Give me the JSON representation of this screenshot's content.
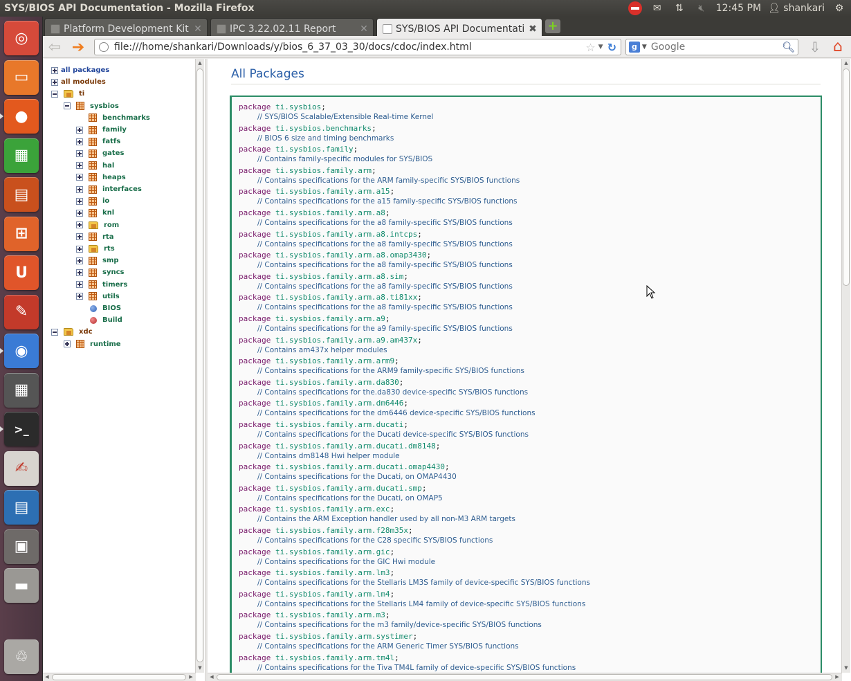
{
  "window": {
    "title": "SYS/BIOS API Documentation - Mozilla Firefox"
  },
  "top_panel": {
    "time": "12:45 PM",
    "user": "shankari"
  },
  "launcher": [
    {
      "name": "ubuntu-dash-icon",
      "color": "#d64a3a"
    },
    {
      "name": "files-folder-icon",
      "color": "#e8782a"
    },
    {
      "name": "firefox-icon",
      "color": "#e3591e"
    },
    {
      "name": "spreadsheet-icon",
      "color": "#3ba33a"
    },
    {
      "name": "presentation-icon",
      "color": "#c9501d"
    },
    {
      "name": "software-center-icon",
      "color": "#e0632a"
    },
    {
      "name": "ubuntu-one-icon",
      "color": "#e0552a"
    },
    {
      "name": "system-settings-icon",
      "color": "#c33a2a"
    },
    {
      "name": "chromium-icon",
      "color": "#3a7bd5"
    },
    {
      "name": "calculator-icon",
      "color": "#555"
    },
    {
      "name": "terminal-icon",
      "color": "#2b2b2b"
    },
    {
      "name": "document-viewer-icon",
      "color": "#d8d4cf"
    },
    {
      "name": "writer-icon",
      "color": "#2d6fb3"
    },
    {
      "name": "workspace-switcher-icon",
      "color": "#6e6a68"
    },
    {
      "name": "disk-drive-icon",
      "color": "#9a9894"
    },
    {
      "name": "trash-icon",
      "color": "#aaa8a4"
    }
  ],
  "tabs": [
    {
      "label": "Platform Development Kit ...",
      "active": false
    },
    {
      "label": "IPC 3.22.02.11 Report",
      "active": false
    },
    {
      "label": "SYS/BIOS API Documentation",
      "active": true
    }
  ],
  "nav": {
    "url": "file:///home/shankari/Downloads/y/bios_6_37_03_30/docs/cdoc/index.html",
    "search_placeholder": "Google",
    "search_engine_letter": "g"
  },
  "tree": [
    {
      "label": "all packages",
      "expander": "plus",
      "icon": "none",
      "level": 0,
      "style": "root"
    },
    {
      "label": "all modules",
      "expander": "plus",
      "icon": "none",
      "level": 0,
      "style": "root-brown"
    },
    {
      "label": "ti",
      "expander": "minus",
      "icon": "folder",
      "level": 0,
      "style": "root-brown"
    },
    {
      "label": "sysbios",
      "expander": "minus",
      "icon": "pkg",
      "level": 1,
      "style": "pkg"
    },
    {
      "label": "benchmarks",
      "expander": "none",
      "icon": "pkg",
      "level": 2,
      "style": "pkg"
    },
    {
      "label": "family",
      "expander": "plus",
      "icon": "pkg",
      "level": 2,
      "style": "pkg"
    },
    {
      "label": "fatfs",
      "expander": "plus",
      "icon": "pkg",
      "level": 2,
      "style": "pkg"
    },
    {
      "label": "gates",
      "expander": "plus",
      "icon": "pkg",
      "level": 2,
      "style": "pkg"
    },
    {
      "label": "hal",
      "expander": "plus",
      "icon": "pkg",
      "level": 2,
      "style": "pkg"
    },
    {
      "label": "heaps",
      "expander": "plus",
      "icon": "pkg",
      "level": 2,
      "style": "pkg"
    },
    {
      "label": "interfaces",
      "expander": "plus",
      "icon": "pkg",
      "level": 2,
      "style": "pkg"
    },
    {
      "label": "io",
      "expander": "plus",
      "icon": "pkg",
      "level": 2,
      "style": "pkg"
    },
    {
      "label": "knl",
      "expander": "plus",
      "icon": "pkg",
      "level": 2,
      "style": "pkg"
    },
    {
      "label": "rom",
      "expander": "plus",
      "icon": "folder",
      "level": 2,
      "style": "pkg"
    },
    {
      "label": "rta",
      "expander": "plus",
      "icon": "pkg",
      "level": 2,
      "style": "pkg"
    },
    {
      "label": "rts",
      "expander": "plus",
      "icon": "folder",
      "level": 2,
      "style": "pkg"
    },
    {
      "label": "smp",
      "expander": "plus",
      "icon": "pkg",
      "level": 2,
      "style": "pkg"
    },
    {
      "label": "syncs",
      "expander": "plus",
      "icon": "pkg",
      "level": 2,
      "style": "pkg"
    },
    {
      "label": "timers",
      "expander": "plus",
      "icon": "pkg",
      "level": 2,
      "style": "pkg"
    },
    {
      "label": "utils",
      "expander": "plus",
      "icon": "pkg",
      "level": 2,
      "style": "pkg"
    },
    {
      "label": "BIOS",
      "expander": "none",
      "icon": "dot-blue",
      "level": 2,
      "style": "pkg"
    },
    {
      "label": "Build",
      "expander": "none",
      "icon": "dot-red",
      "level": 2,
      "style": "pkg"
    },
    {
      "label": "xdc",
      "expander": "minus",
      "icon": "folder",
      "level": 0,
      "style": "root-brown"
    },
    {
      "label": "runtime",
      "expander": "plus",
      "icon": "pkg",
      "level": 1,
      "style": "pkg"
    }
  ],
  "main": {
    "heading": "All Packages",
    "keyword": "package",
    "packages": [
      {
        "name": "ti.sysbios",
        "desc": "// SYS/BIOS Scalable/Extensible Real-time Kernel"
      },
      {
        "name": "ti.sysbios.benchmarks",
        "desc": "// BIOS 6 size and timing benchmarks"
      },
      {
        "name": "ti.sysbios.family",
        "desc": "// Contains family-specific modules for SYS/BIOS"
      },
      {
        "name": "ti.sysbios.family.arm",
        "desc": "// Contains specifications for the ARM family-specific SYS/BIOS functions"
      },
      {
        "name": "ti.sysbios.family.arm.a15",
        "desc": "// Contains specifications for the a15 family-specific SYS/BIOS functions"
      },
      {
        "name": "ti.sysbios.family.arm.a8",
        "desc": "// Contains specifications for the a8 family-specific SYS/BIOS functions"
      },
      {
        "name": "ti.sysbios.family.arm.a8.intcps",
        "desc": "// Contains specifications for the a8 family-specific SYS/BIOS functions"
      },
      {
        "name": "ti.sysbios.family.arm.a8.omap3430",
        "desc": "// Contains specifications for the a8 family-specific SYS/BIOS functions"
      },
      {
        "name": "ti.sysbios.family.arm.a8.sim",
        "desc": "// Contains specifications for the a8 family-specific SYS/BIOS functions"
      },
      {
        "name": "ti.sysbios.family.arm.a8.ti81xx",
        "desc": "// Contains specifications for the a8 family-specific SYS/BIOS functions"
      },
      {
        "name": "ti.sysbios.family.arm.a9",
        "desc": "// Contains specifications for the a9 family-specific SYS/BIOS functions"
      },
      {
        "name": "ti.sysbios.family.arm.a9.am437x",
        "desc": "// Contains am437x helper modules"
      },
      {
        "name": "ti.sysbios.family.arm.arm9",
        "desc": "// Contains specifications for the ARM9 family-specific SYS/BIOS functions"
      },
      {
        "name": "ti.sysbios.family.arm.da830",
        "desc": "// Contains specifications for the.da830 device-specific SYS/BIOS functions"
      },
      {
        "name": "ti.sysbios.family.arm.dm6446",
        "desc": "// Contains specifications for the dm6446 device-specific SYS/BIOS functions"
      },
      {
        "name": "ti.sysbios.family.arm.ducati",
        "desc": "// Contains specifications for the Ducati device-specific SYS/BIOS functions"
      },
      {
        "name": "ti.sysbios.family.arm.ducati.dm8148",
        "desc": "// Contains dm8148 Hwi helper module"
      },
      {
        "name": "ti.sysbios.family.arm.ducati.omap4430",
        "desc": "// Contains specifications for the Ducati, on OMAP4430"
      },
      {
        "name": "ti.sysbios.family.arm.ducati.smp",
        "desc": "// Contains specifications for the Ducati, on OMAP5"
      },
      {
        "name": "ti.sysbios.family.arm.exc",
        "desc": "// Contains the ARM Exception handler used by all non-M3 ARM targets"
      },
      {
        "name": "ti.sysbios.family.arm.f28m35x",
        "desc": "// Contains specifications for the C28 specific SYS/BIOS functions"
      },
      {
        "name": "ti.sysbios.family.arm.gic",
        "desc": "// Contains specifications for the GIC Hwi module"
      },
      {
        "name": "ti.sysbios.family.arm.lm3",
        "desc": "// Contains specifications for the Stellaris LM3S family of device-specific SYS/BIOS functions"
      },
      {
        "name": "ti.sysbios.family.arm.lm4",
        "desc": "// Contains specifications for the Stellaris LM4 family of device-specific SYS/BIOS functions"
      },
      {
        "name": "ti.sysbios.family.arm.m3",
        "desc": "// Contains specifications for the m3 family/device-specific SYS/BIOS functions"
      },
      {
        "name": "ti.sysbios.family.arm.systimer",
        "desc": "// Contains specifications for the ARM Generic Timer SYS/BIOS functions"
      },
      {
        "name": "ti.sysbios.family.arm.tm4l",
        "desc": "// Contains specifications for the Tiva TM4L family of device-specific SYS/BIOS functions"
      }
    ]
  }
}
